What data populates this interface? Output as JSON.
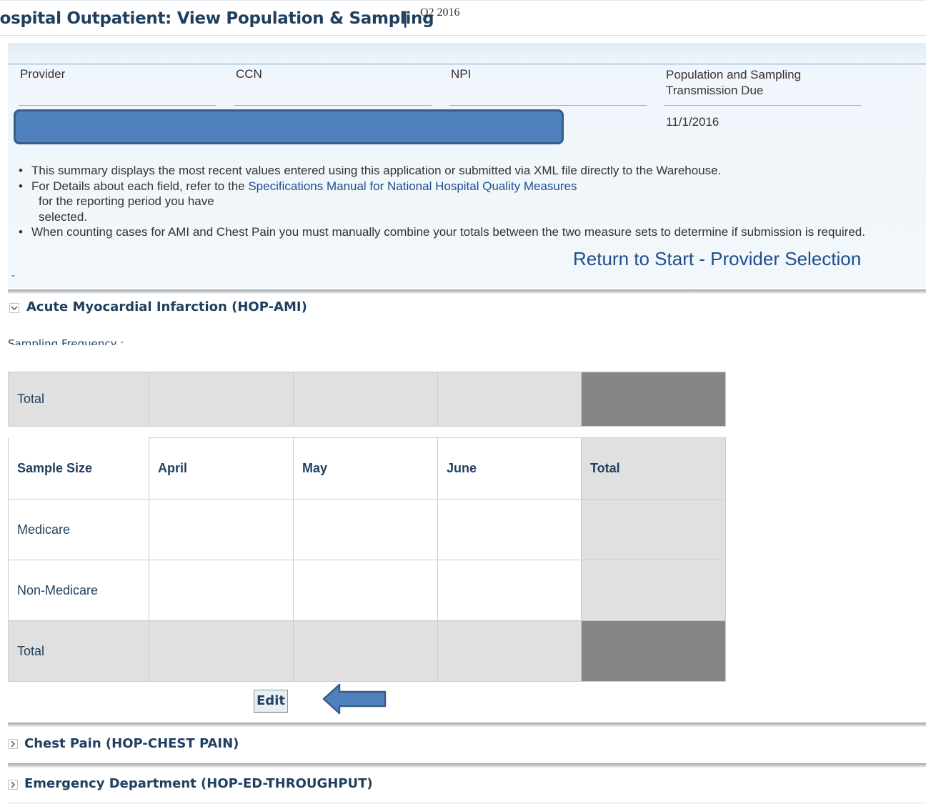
{
  "header": {
    "title": "Hospital Outpatient: View Population & Sampling",
    "title_visible": "lospital Outpatient: View Population & Sampling",
    "separator": "|",
    "period": "Q2 2016"
  },
  "info": {
    "provider_label": "Provider",
    "ccn_label": "CCN",
    "npi_label": "NPI",
    "due_label_line1": "Population and Sampling",
    "due_label_line2": "Transmission Due",
    "due_date": "11/1/2016",
    "bullets": {
      "b1": "This summary displays the most recent values entered using this application or submitted via XML file directly to the Warehouse.",
      "b2_prefix": "For Details about each field, refer to the",
      "b2_link": "Specifications Manual for National Hospital Quality Measures",
      "b2_line2": "for the reporting period you have",
      "b2_line3": "selected.",
      "b3": "When counting cases for AMI and Chest Pain you must manually combine your totals between the two measure sets to determine if submission is required."
    },
    "return_link": "Return to Start - Provider Selection",
    "dash": "-"
  },
  "sections": {
    "ami": {
      "title": "Acute Myocardial Infarction (HOP-AMI)",
      "expanded": true,
      "icon": "chevron-down-icon"
    },
    "chest": {
      "title": "Chest Pain (HOP-CHEST PAIN)",
      "expanded": false,
      "icon": "chevron-right-icon"
    },
    "ed": {
      "title": "Emergency Department (HOP-ED-THROUGHPUT)",
      "expanded": false,
      "icon": "chevron-right-icon"
    }
  },
  "sampling_frequency_label": "Sampling Frequency :",
  "population_table": {
    "total_label": "Total"
  },
  "sample_table": {
    "headers": [
      "Sample Size",
      "April",
      "May",
      "June",
      "Total"
    ],
    "rows": [
      {
        "label": "Medicare"
      },
      {
        "label": "Non-Medicare"
      },
      {
        "label": "Total"
      }
    ]
  },
  "edit_label": "Edit",
  "colors": {
    "title": "#1f3f5f",
    "link": "#1f4e8c",
    "panel": "#eef4fa",
    "highlight_box": "#4f81bd",
    "arrow": "#4f81bd",
    "cell_gray": "#e0e0e0",
    "cell_dark": "#858585"
  }
}
